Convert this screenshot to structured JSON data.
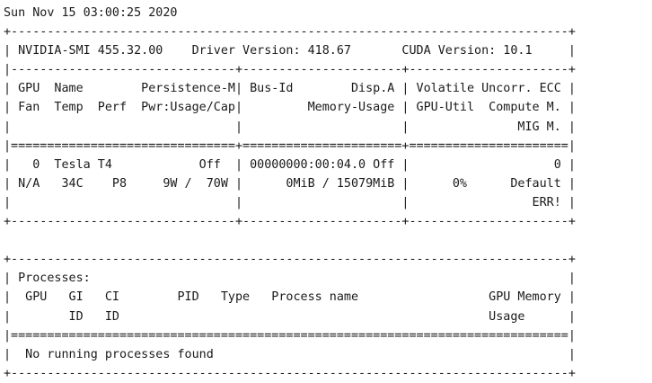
{
  "terminal": {
    "lines": [
      "Sun Nov 15 03:00:25 2020",
      "+-----------------------------------------------------------------------------+",
      "| NVIDIA-SMI 455.32.00    Driver Version: 418.67       CUDA Version: 10.1     |",
      "|-------------------------------+----------------------+----------------------+",
      "| GPU  Name        Persistence-M| Bus-Id        Disp.A | Volatile Uncorr. ECC |",
      "| Fan  Temp  Perf  Pwr:Usage/Cap|         Memory-Usage | GPU-Util  Compute M. |",
      "|                               |                      |               MIG M. |",
      "|===============================+======================+======================|",
      "|   0  Tesla T4            Off  | 00000000:00:04.0 Off |                    0 |",
      "| N/A   34C    P8     9W /  70W |      0MiB / 15079MiB |      0%      Default |",
      "|                               |                      |                 ERR! |",
      "+-------------------------------+----------------------+----------------------+",
      "",
      "+-----------------------------------------------------------------------------+",
      "| Processes:                                                                  |",
      "|  GPU   GI   CI        PID   Type   Process name                  GPU Memory |",
      "|        ID   ID                                                   Usage      |",
      "|=============================================================================|",
      "|  No running processes found                                                 |",
      "+-----------------------------------------------------------------------------+"
    ]
  }
}
